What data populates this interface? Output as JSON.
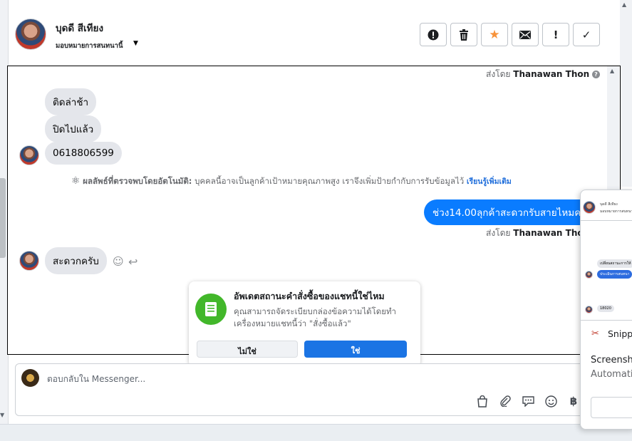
{
  "header": {
    "name": "บุดดี สีเทียง",
    "assign_label": "มอบหมายการสนทนานี้",
    "actions": [
      {
        "name": "report-button",
        "icon": "exclamation-circle-icon",
        "glyph": "!"
      },
      {
        "name": "delete-button",
        "icon": "trash-icon",
        "glyph": ""
      },
      {
        "name": "star-button",
        "icon": "star-icon",
        "glyph": "★"
      },
      {
        "name": "mark-unread-button",
        "icon": "envelope-icon",
        "glyph": ""
      },
      {
        "name": "follow-up-button",
        "icon": "exclamation-icon",
        "glyph": "!"
      },
      {
        "name": "mark-done-button",
        "icon": "check-icon",
        "glyph": "✓"
      }
    ]
  },
  "chat": {
    "sent_by_prefix": "ส่งโดย",
    "sent_by_name": "Thanawan Thon",
    "messages_in_1": [
      "ติดล่าช้า",
      "ปิดไปแล้ว",
      "0618806599"
    ],
    "auto_note_label": "ผลลัพธ์ที่ตรวจพบโดยอัตโนมัติ:",
    "auto_note_text": "บุคคลนี้อาจเป็นลูกค้าเป้าหมายคุณภาพสูง เราจึงเพิ่มป้ายกำกับการรับข้อมูลไว้",
    "auto_note_link": "เรียนรู้เพิ่มเติม",
    "outgoing": "ช่วง14.00ลุกค้าสะดวกรับสายไหมคะ",
    "sent_by_2": "ส่งโดย",
    "sent_by_name_2": "Thanawan Thon",
    "incoming_last": "สะดวกครับ"
  },
  "card": {
    "title": "อัพเดตสถานะคำสั่งซื้อของแชทนี้ใช่ไหม",
    "body": "คุณสามารถจัดระเบียบกล่องข้อความได้โดยทำเครื่องหมายแชทนี้ว่า \"สั่งซื้อแล้ว\"",
    "no_label": "ไม่ใช่",
    "yes_label": "ใช่"
  },
  "composer": {
    "placeholder": "ตอบกลับใน Messenger...",
    "icons": [
      "shopping-bag-icon",
      "paperclip-icon",
      "saved-reply-icon",
      "emoji-icon",
      "baht-icon"
    ]
  },
  "popup": {
    "name": "บุดดี สีเทียง",
    "sub": "มอบหมายการสนทนานี้",
    "bubble1": "เปลี่ยนสถานะการให้",
    "bubble2": "ประเมินการสนทนา",
    "bubble3": "18020",
    "snip_label": "Snippi",
    "line1": "Screensho",
    "line2": "Automati"
  }
}
